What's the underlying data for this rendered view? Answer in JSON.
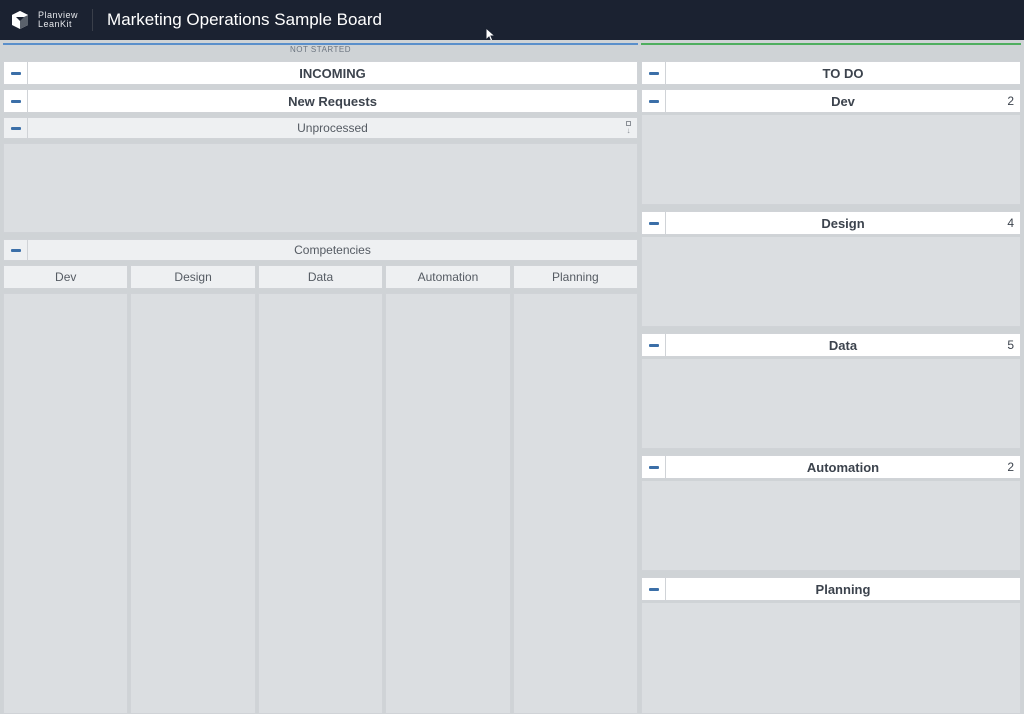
{
  "header": {
    "brand_line1": "Planview",
    "brand_line2": "LeanKit",
    "board_title": "Marketing Operations Sample Board"
  },
  "phase_not_started": "NOT STARTED",
  "incoming": {
    "title": "INCOMING",
    "new_requests": "New Requests",
    "unprocessed": "Unprocessed",
    "competencies_label": "Competencies",
    "comp_columns": {
      "dev": "Dev",
      "design": "Design",
      "data": "Data",
      "automation": "Automation",
      "planning": "Planning"
    }
  },
  "todo": {
    "title": "TO DO",
    "lanes": {
      "dev": {
        "label": "Dev",
        "count": "2"
      },
      "design": {
        "label": "Design",
        "count": "4"
      },
      "data": {
        "label": "Data",
        "count": "5"
      },
      "automation": {
        "label": "Automation",
        "count": "2"
      },
      "planning": {
        "label": "Planning",
        "count": ""
      }
    }
  }
}
